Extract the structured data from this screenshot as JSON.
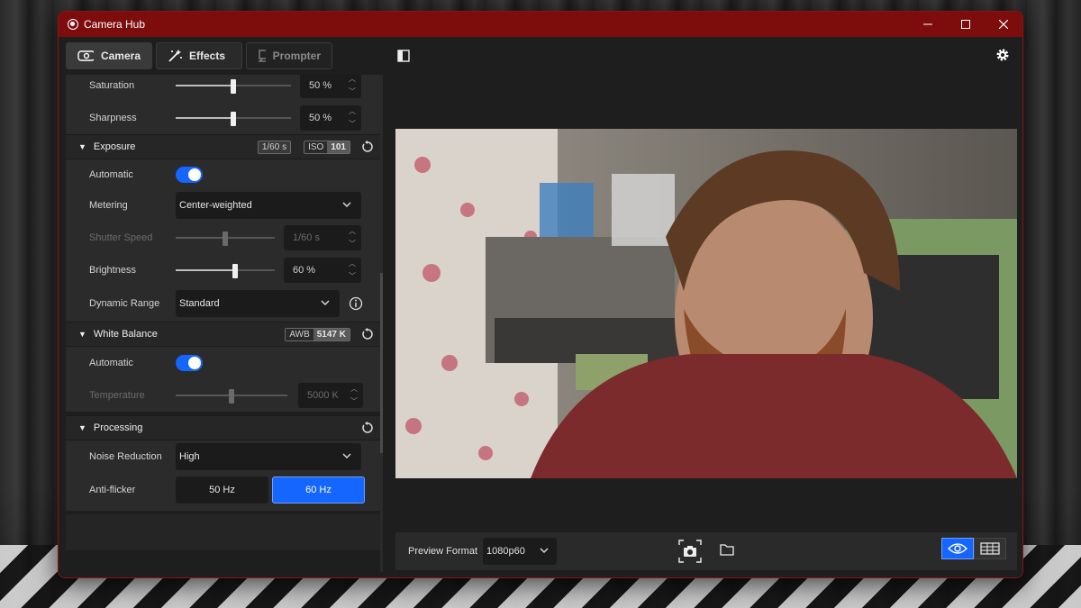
{
  "window": {
    "title": "Camera Hub"
  },
  "tabs": [
    {
      "label": "Camera",
      "icon": "camera-icon",
      "state": "active"
    },
    {
      "label": "Effects",
      "icon": "magic-wand-icon",
      "state": "normal"
    },
    {
      "label": "Prompter",
      "icon": "prompter-icon",
      "state": "disabled"
    }
  ],
  "image_section": {
    "saturation": {
      "label": "Saturation",
      "value": "50 %",
      "level": 0.5
    },
    "sharpness": {
      "label": "Sharpness",
      "value": "50 %",
      "level": 0.5
    }
  },
  "exposure": {
    "title": "Exposure",
    "shutter_badge": "1/60 s",
    "iso_key": "ISO",
    "iso_value": "101",
    "automatic_label": "Automatic",
    "automatic_on": true,
    "metering_label": "Metering",
    "metering_value": "Center-weighted",
    "shutter_label": "Shutter Speed",
    "shutter_value": "1/60 s",
    "shutter_level": 0.5,
    "brightness_label": "Brightness",
    "brightness_value": "60 %",
    "brightness_level": 0.6,
    "dynamic_range_label": "Dynamic Range",
    "dynamic_range_value": "Standard"
  },
  "white_balance": {
    "title": "White Balance",
    "awb_key": "AWB",
    "awb_value": "5147 K",
    "automatic_label": "Automatic",
    "automatic_on": true,
    "temperature_label": "Temperature",
    "temperature_value": "5000 K",
    "temperature_level": 0.5
  },
  "processing": {
    "title": "Processing",
    "noise_label": "Noise Reduction",
    "noise_value": "High",
    "flicker_label": "Anti-flicker",
    "flicker_options": [
      "50 Hz",
      "60 Hz"
    ],
    "flicker_selected": "60 Hz"
  },
  "bottom": {
    "preview_format_label": "Preview Format",
    "preview_format_value": "1080p60"
  },
  "colors": {
    "accent": "#1565ff",
    "titlebar": "#7d0d0d"
  }
}
